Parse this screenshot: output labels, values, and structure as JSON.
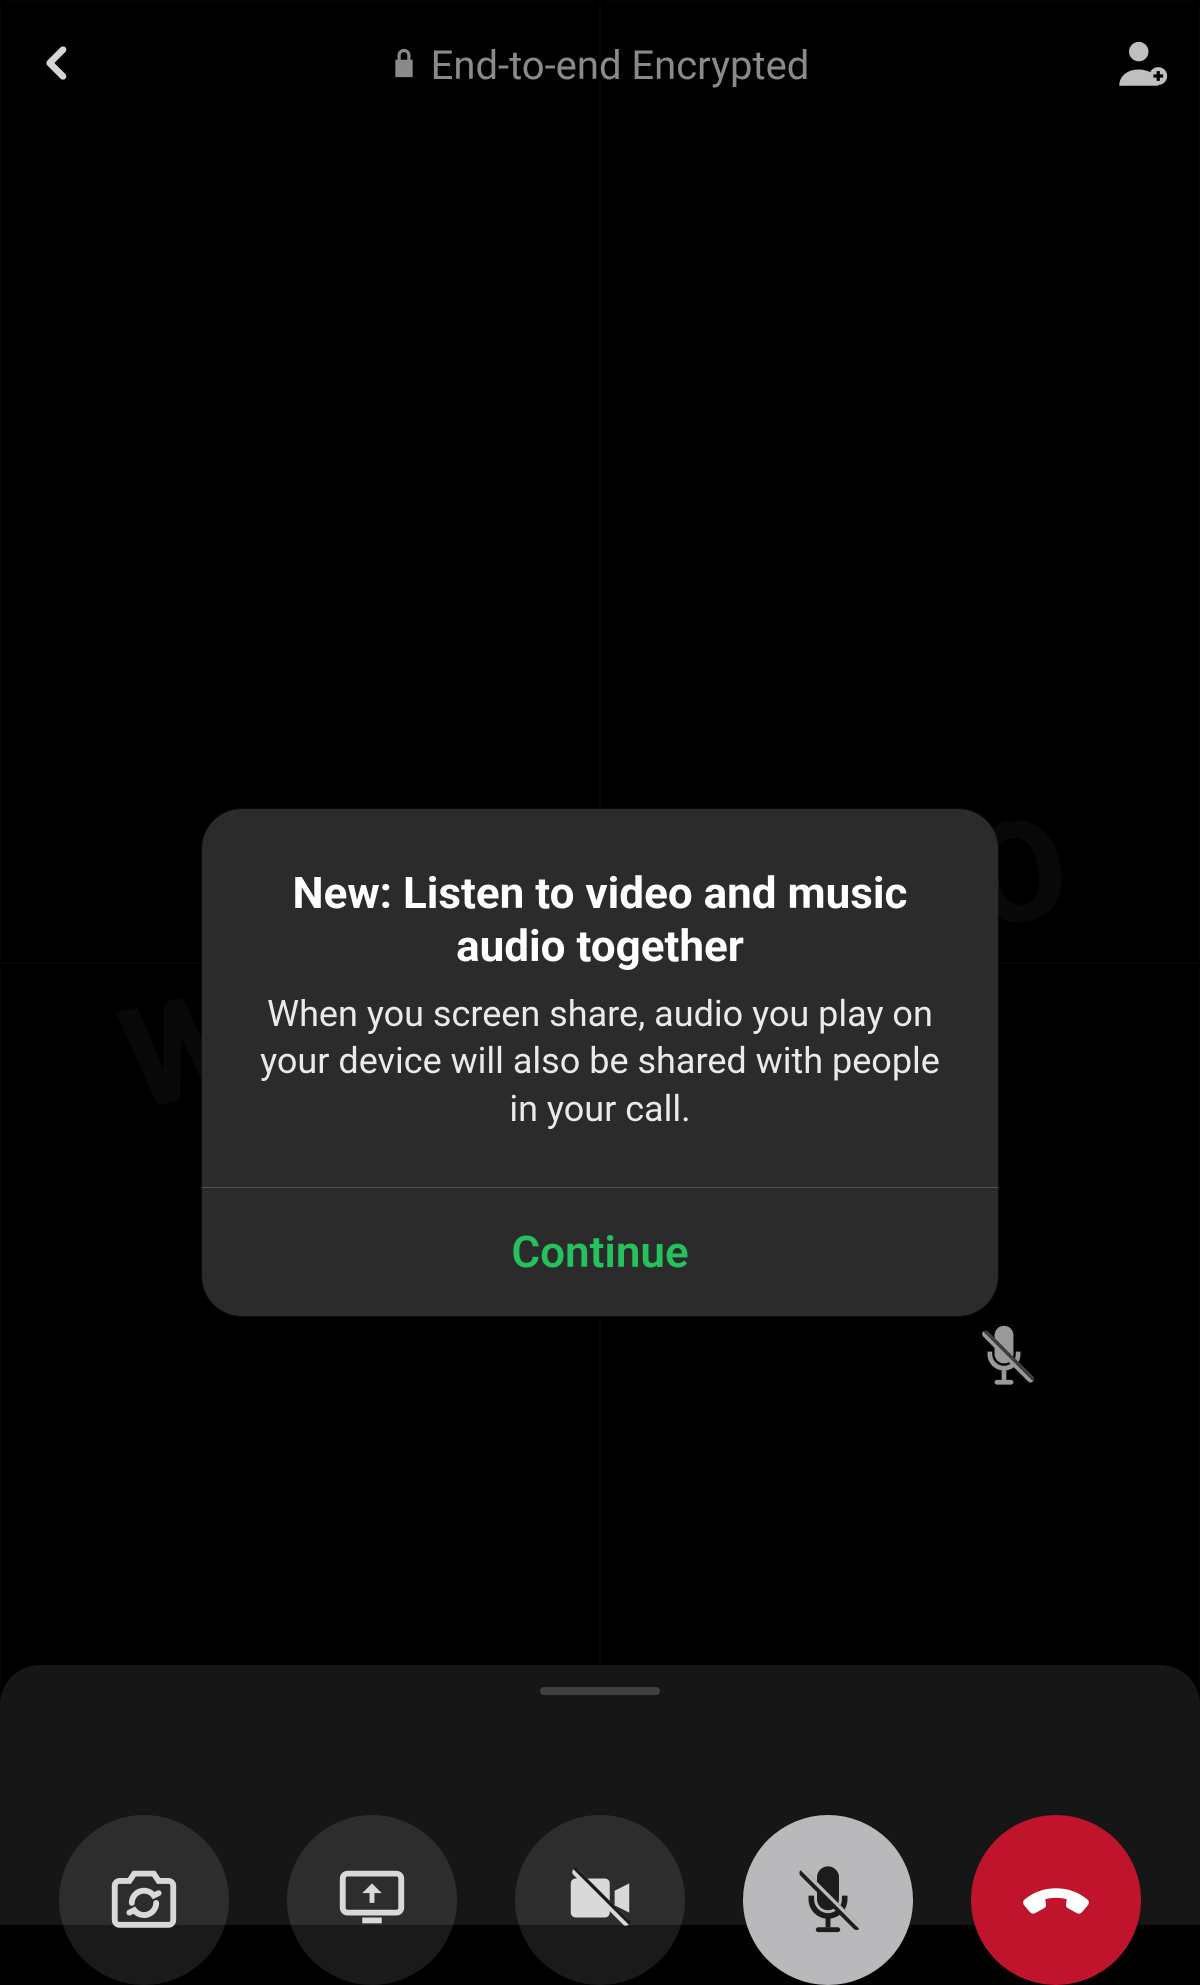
{
  "header": {
    "encrypted_label": "End-to-end Encrypted"
  },
  "modal": {
    "title": "New: Listen to video and music audio together",
    "body": "When you screen share, audio you play on your device will also be shared with people in your call.",
    "continue_label": "Continue"
  },
  "icons": {
    "back": "chevron-left",
    "lock": "lock",
    "add_user": "person-add",
    "mic_muted_badge": "mic-off",
    "flip_camera": "camera-flip",
    "screen_share": "screen-share",
    "video_off": "video-off",
    "mic": "mic-off",
    "end_call": "phone-hangup"
  },
  "colors": {
    "accent_green": "#25c15c",
    "end_call_red": "#C0142C",
    "modal_bg": "#2b2b2b"
  }
}
